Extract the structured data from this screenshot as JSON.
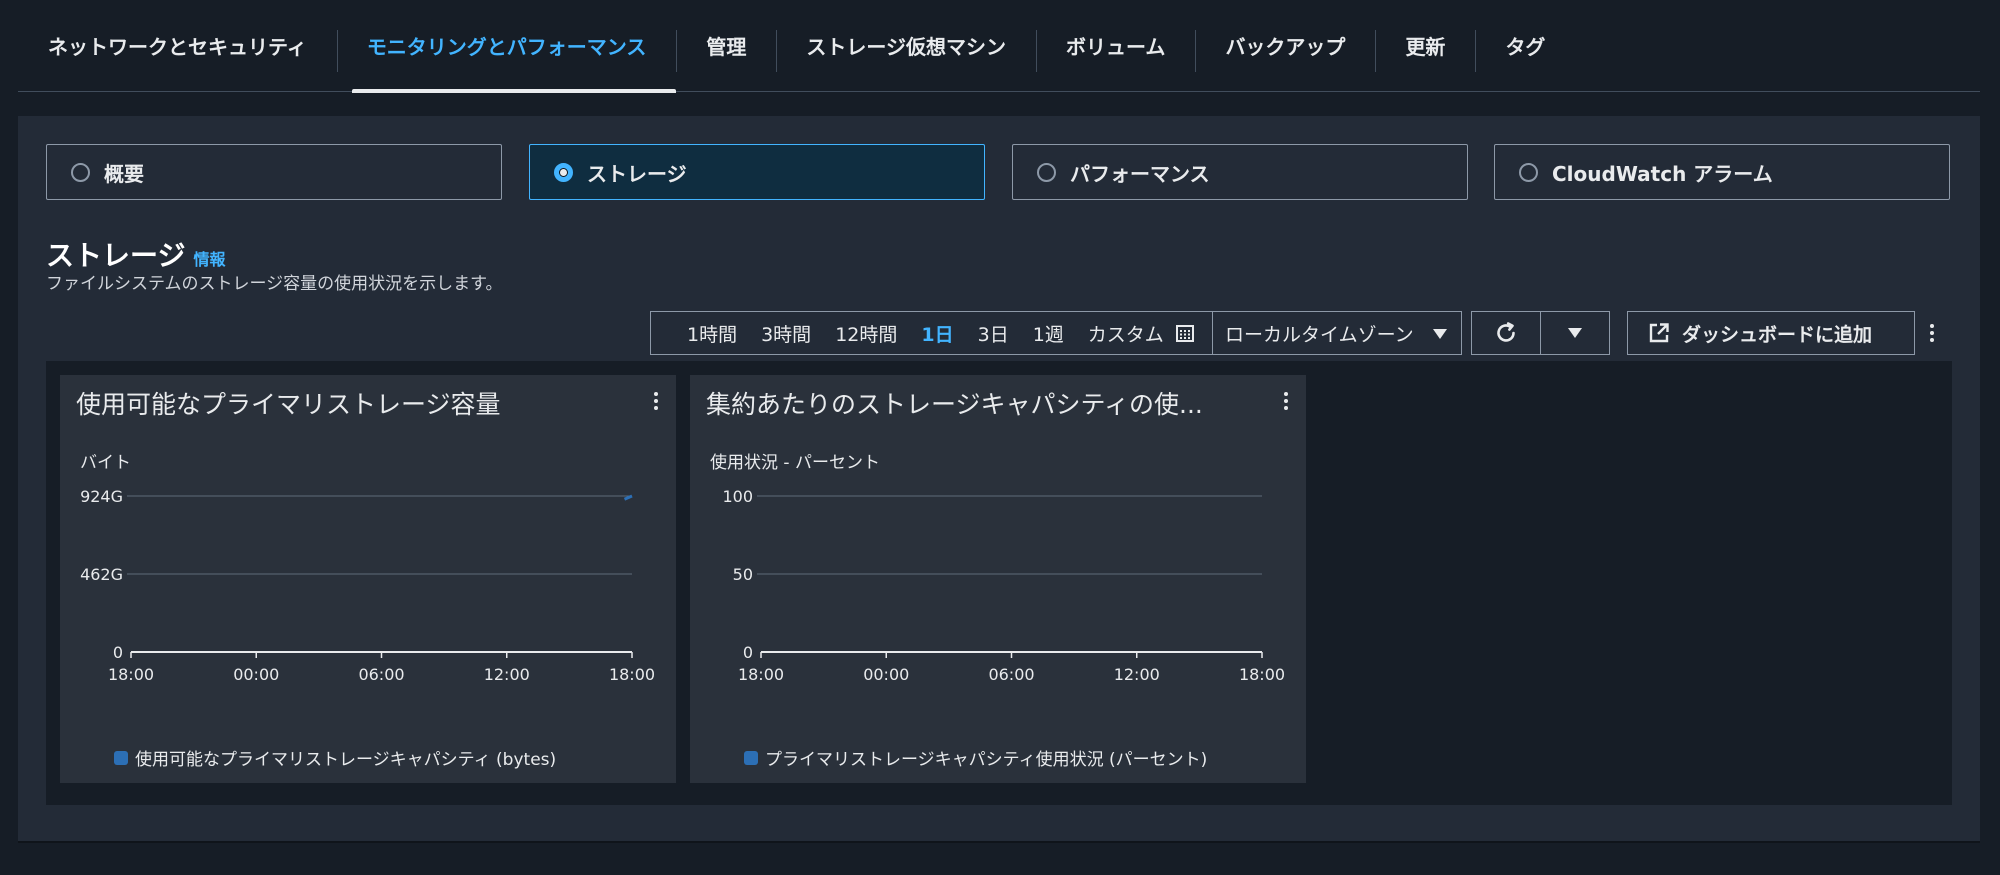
{
  "tabs": [
    {
      "label": "ネットワークとセキュリティ",
      "active": false
    },
    {
      "label": "モニタリングとパフォーマンス",
      "active": true
    },
    {
      "label": "管理",
      "active": false
    },
    {
      "label": "ストレージ仮想マシン",
      "active": false
    },
    {
      "label": "ボリューム",
      "active": false
    },
    {
      "label": "バックアップ",
      "active": false
    },
    {
      "label": "更新",
      "active": false
    },
    {
      "label": "タグ",
      "active": false
    }
  ],
  "segments": [
    {
      "label": "概要",
      "selected": false
    },
    {
      "label": "ストレージ",
      "selected": true
    },
    {
      "label": "パフォーマンス",
      "selected": false
    },
    {
      "label": "CloudWatch アラーム",
      "selected": false
    }
  ],
  "section": {
    "title": "ストレージ",
    "info": "情報",
    "description": "ファイルシステムのストレージ容量の使用状況を示します。"
  },
  "controls": {
    "ranges": [
      {
        "label": "1時間",
        "active": false
      },
      {
        "label": "3時間",
        "active": false
      },
      {
        "label": "12時間",
        "active": false
      },
      {
        "label": "1日",
        "active": true
      },
      {
        "label": "3日",
        "active": false
      },
      {
        "label": "1週",
        "active": false
      },
      {
        "label": "カスタム",
        "active": false
      }
    ],
    "timezone": "ローカルタイムゾーン",
    "add_to_dashboard": "ダッシュボードに追加"
  },
  "colors": {
    "accent": "#42b4ff",
    "series": "#2c6fb5",
    "grid": "#5f6b7a"
  },
  "chart_data": [
    {
      "type": "line",
      "title": "使用可能なプライマリストレージ容量",
      "ylabel": "バイト",
      "x_ticks": [
        "18:00",
        "00:00",
        "06:00",
        "12:00",
        "18:00"
      ],
      "y_ticks": [
        "924G",
        "462G",
        "0"
      ],
      "ylim": [
        0,
        924
      ],
      "y_unit": "G",
      "series": [
        {
          "name": "使用可能なプライマリストレージキャパシティ (bytes)",
          "x": [
            0.985,
            1.0
          ],
          "values": [
            905,
            924
          ]
        }
      ]
    },
    {
      "type": "line",
      "title": "集約あたりのストレージキャパシティの使...",
      "ylabel": "使用状況 - パーセント",
      "x_ticks": [
        "18:00",
        "00:00",
        "06:00",
        "12:00",
        "18:00"
      ],
      "y_ticks": [
        "100",
        "50",
        "0"
      ],
      "ylim": [
        0,
        100
      ],
      "series": [
        {
          "name": "プライマリストレージキャパシティ使用状況 (パーセント)",
          "x": [],
          "values": []
        }
      ]
    }
  ]
}
